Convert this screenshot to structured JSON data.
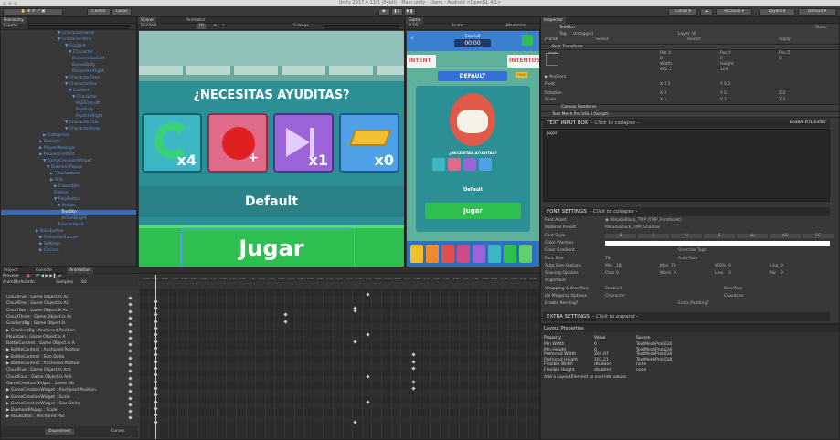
{
  "window": {
    "title": "Unity 2017.4.11f1 (64bit) - Main.unity - Users - Android <OpenGL 4.1>"
  },
  "toolbar": {
    "center_label": "Center",
    "local_label": "Local",
    "collab_label": "Collab",
    "account_label": "Account",
    "layers_label": "Layers",
    "layout_label": "Default"
  },
  "hierarchy": {
    "tab": "Hierarchy",
    "create_label": "Create",
    "items": [
      "▼ CharacterHome",
      "▼ CharacterBtns",
      "▼ Content",
      "▼ Character",
      "BonusArrowLeft",
      "BonusBody",
      "BonusArmRight",
      "▼ CharacterTime",
      "▼ CharacterRec",
      "▼ Content",
      "▼ Character",
      "PopArmLeft",
      "PopBody",
      "PopArmRight",
      "▼ CharacterTitle",
      "▼ CharacterBody",
      "▶ Categories",
      "▶ Confetti",
      "▶ PlayerMessage",
      "▶ PausedContent",
      "▼ GameCreationWidget",
      "▼ DiamondPopup",
      "▶ TitleContent",
      "▶ Hills",
      "▶ ClosedBtn",
      "Ribbon",
      "▼ PlayButton",
      "▼ Button",
      "TextBtn",
      "ActiveBright",
      "TutorialHand",
      "▶ Backbutton",
      "▶ PreloaderBanner",
      "▶ Settings",
      "▶ Canvas"
    ]
  },
  "scene": {
    "tab_scene": "Scene",
    "tab_animator": "Animator",
    "shaded": "Shaded",
    "mode_2d": "2D",
    "gizmos": "Gizmos",
    "search": "All"
  },
  "game_popup": {
    "title": "¿NECESITAS AYUDITAS?",
    "boost_counts": [
      "x4",
      "",
      "x1",
      "x0"
    ],
    "category": "Default",
    "play": "Jugar"
  },
  "game_view": {
    "tab": "Game",
    "aspect": "9:16",
    "scale": "Scale",
    "maximize": "Maximize",
    "timer_label": "Time left",
    "timer": "00:00",
    "intentos_left": "INTENT",
    "intentos_right": "INTENTOS",
    "default_banner": "DEFAULT",
    "badge": "FREE",
    "popup_title": "¿NECESITAS AYUDITAS?",
    "category": "Default",
    "play": "Jugar"
  },
  "inspector": {
    "tab": "Inspector",
    "object_name": "TextBtn",
    "static": "Static",
    "tag_label": "Tag",
    "tag_value": "Untagged",
    "layer_label": "Layer",
    "layer_value": "UI",
    "prefab_label": "Prefab",
    "select": "Select",
    "revert": "Revert",
    "apply": "Apply",
    "rect_transform": "Rect Transform",
    "stretch": "stretch",
    "pos_x": "Pos X",
    "pos_y": "Pos Y",
    "pos_z": "Pos Z",
    "v_posx": "0",
    "v_posy": "0",
    "v_posz": "0",
    "width_l": "Width",
    "height_l": "Height",
    "v_width": "462.7",
    "v_height": "109",
    "anchors": "▶ Anchors",
    "pivot": "Pivot",
    "pivot_x": "X  0.5",
    "pivot_y": "Y  0.5",
    "rotation": "Rotation",
    "rot_x": "X  0",
    "rot_y": "Y  0",
    "rot_z": "Z  0",
    "scale": "Scale",
    "sc_x": "X  1",
    "sc_y": "Y  1",
    "sc_z": "Z  1",
    "canvas_renderer": "Canvas Renderer",
    "tmp_component": "Text Mesh Pro UGUI (Script)",
    "text_input": "TEXT INPUT BOX",
    "text_input_hint": "- Click to collapse -",
    "rtl": "Enable RTL Editor",
    "text_value": "Jugar",
    "font_settings": "FONT SETTINGS",
    "font_settings_hint": "- Click to collapse -",
    "font_asset_l": "Font Asset",
    "font_asset_v": "◉ MikadoBlack_TMP (TMP_FontAsset)",
    "material_l": "Material Preset",
    "material_v": "MikadoBlack_TMP_Shadow",
    "style_l": "Font Style",
    "style_b": "B",
    "style_i": "I",
    "style_u": "U",
    "style_s": "S",
    "style_ab": "ab",
    "style_AB": "AB",
    "style_SC": "SC",
    "vertex_l": "Color (Vertex)",
    "gradient_l": "Color Gradient",
    "override_l": "Override Tags",
    "size_l": "Font Size",
    "size_v": "78",
    "autosize_l": "Auto Size",
    "autosize_opts_l": "Auto Size Options",
    "min_l": "Min",
    "min_v": "18",
    "max_l": "Max",
    "max_v": "78",
    "wd_l": "WD%",
    "wd_v": "0",
    "line_l": "Line",
    "line_v": "0",
    "spacing_l": "Spacing Options",
    "char_l": "Char",
    "char_v": "0",
    "word_l": "Word",
    "word_v": "0",
    "line2_l": "Line",
    "line2_v": "0",
    "par_l": "Par.",
    "par_v": "0",
    "align_l": "Alignment",
    "wrap_l": "Wrapping & Overflow",
    "wrap_v": "Enabled",
    "overflow_v": "Overflow",
    "uv_l": "UV Mapping Options",
    "uv_v": "Character",
    "uv2_v": "Character",
    "kerning_l": "Enable Kerning?",
    "padding_l": "Extra Padding?",
    "extra": "EXTRA SETTINGS",
    "extra_hint": "- Click to expand -"
  },
  "layout_properties": {
    "title": "Layout Properties",
    "headers": [
      "Property",
      "Value",
      "Source"
    ],
    "rows": [
      [
        "Min Width",
        "0",
        "TextMeshProUGUI"
      ],
      [
        "Min Height",
        "0",
        "TextMeshProUGUI"
      ],
      [
        "Preferred Width",
        "204.07",
        "TextMeshProUGUI"
      ],
      [
        "Preferred Height",
        "101.21",
        "TextMeshProUGUI"
      ],
      [
        "Flexible Width",
        "disabled",
        "none"
      ],
      [
        "Flexible Height",
        "disabled",
        "none"
      ]
    ],
    "hint": "Add a LayoutElement to override values."
  },
  "bottom": {
    "tab_project": "Project",
    "tab_console": "Console",
    "tab_animation": "Animation",
    "preview": "Preview",
    "clip": "AnimBtnAnimIn",
    "samples_l": "Samples",
    "samples_v": "60",
    "rows": [
      "CloudFive : Game Object.Is Ac",
      "CloudOne : Game Object.Is Ac",
      "CloudTwo : Game Object.Is Ac",
      "CloudThree : Game Object.Is Ac",
      "GradientBg : Game Object.Is",
      "▶ GradientBg : Anchored Position",
      "Mountain : Game Object.Is A",
      "BattleContent : Game Object.Is A",
      "▶ BattleContent : Anchored Position",
      "▶ BattleContent : Size Delta",
      "▶ BattleContent : Anchored Position",
      "CloudFive : Game Object.Is Acti",
      "CloudFour : Game Object.Is Acti",
      "GameCreationWidget : Game Ob",
      "▶ GameCreationWidget : Anchored Position",
      "▶ GameCreationWidget : Scale",
      "▶ GameCreationWidget : Size Delta",
      "▶ DiamondPopup : Scale",
      "▶ RbuButton : Anchored Pos"
    ],
    "dopesheet": "Dopesheet",
    "curves": "Curves",
    "ticks": [
      "0:00",
      "0:10",
      "0:20",
      "0:30",
      "0:40",
      "0:50",
      "1:00",
      "1:10",
      "1:20",
      "1:30",
      "1:40",
      "1:50",
      "2:00",
      "2:10",
      "2:20",
      "2:30",
      "2:40",
      "2:50",
      "3:00",
      "3:10",
      "3:20",
      "3:30",
      "3:40",
      "3:50",
      "4:00",
      "4:10",
      "4:20",
      "4:30",
      "4:40",
      "4:50",
      "5:00",
      "5:10",
      "5:20",
      "5:30",
      "5:40",
      "5:50",
      "6:00",
      "6:10",
      "6:20",
      "6:30",
      "6:40"
    ]
  },
  "colors": {
    "selection": "#3f6bb0",
    "hierarchy_blue": "#5b93e0",
    "game_bg": "#5fb09a",
    "button_green": "#2fbf51",
    "popup_teal": "#2c8f95"
  }
}
